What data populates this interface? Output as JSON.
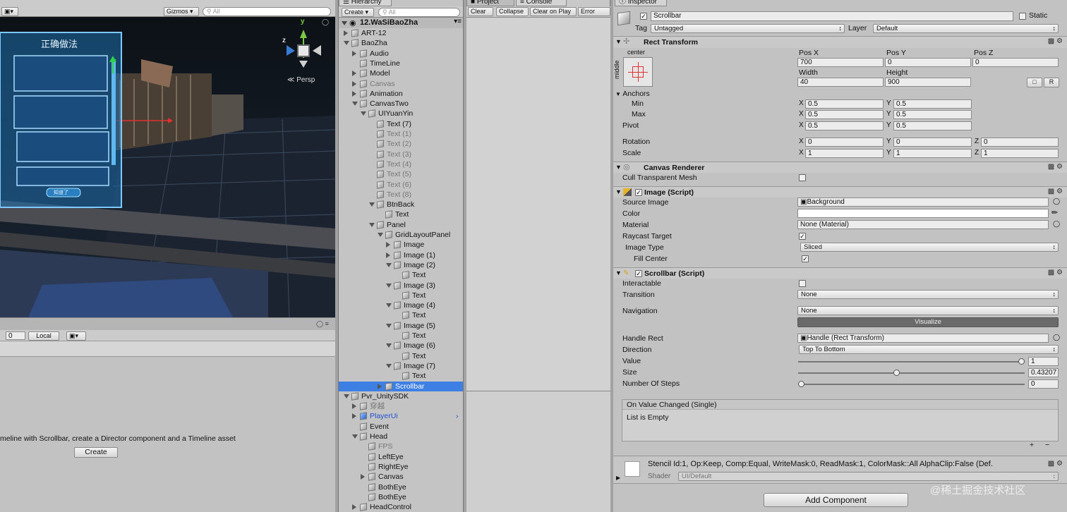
{
  "scene": {
    "gizmos": "Gizmos",
    "search_placeholder": "All",
    "persp": "Persp",
    "axis_y": "y",
    "axis_z": "z",
    "panel_title": "正确做法",
    "panel_button": "知道了"
  },
  "timeline": {
    "frame": "0",
    "local": "Local",
    "message": "meline with Scrollbar, create a Director component and a Timeline asset",
    "create": "Create"
  },
  "hierarchy": {
    "tab": "Hierarchy",
    "create": "Create",
    "search_placeholder": "All",
    "scene_name": "12.WaSiBaoZha",
    "rows": [
      {
        "label": "ART-12",
        "depth": 1,
        "tri": "closed",
        "style": ""
      },
      {
        "label": "BaoZha",
        "depth": 1,
        "tri": "open",
        "style": ""
      },
      {
        "label": "Audio",
        "depth": 2,
        "tri": "closed",
        "style": ""
      },
      {
        "label": "TimeLine",
        "depth": 2,
        "tri": "",
        "style": ""
      },
      {
        "label": "Model",
        "depth": 2,
        "tri": "closed",
        "style": ""
      },
      {
        "label": "Canvas",
        "depth": 2,
        "tri": "closed",
        "style": "dim"
      },
      {
        "label": "Animation",
        "depth": 2,
        "tri": "closed",
        "style": ""
      },
      {
        "label": "CanvasTwo",
        "depth": 2,
        "tri": "open",
        "style": ""
      },
      {
        "label": "UIYuanYin",
        "depth": 3,
        "tri": "open",
        "style": ""
      },
      {
        "label": "Text (7)",
        "depth": 4,
        "tri": "",
        "style": ""
      },
      {
        "label": "Text (1)",
        "depth": 4,
        "tri": "",
        "style": "dim"
      },
      {
        "label": "Text (2)",
        "depth": 4,
        "tri": "",
        "style": "dim"
      },
      {
        "label": "Text (3)",
        "depth": 4,
        "tri": "",
        "style": "dim"
      },
      {
        "label": "Text (4)",
        "depth": 4,
        "tri": "",
        "style": "dim"
      },
      {
        "label": "Text (5)",
        "depth": 4,
        "tri": "",
        "style": "dim"
      },
      {
        "label": "Text (6)",
        "depth": 4,
        "tri": "",
        "style": "dim"
      },
      {
        "label": "Text (8)",
        "depth": 4,
        "tri": "",
        "style": "dim"
      },
      {
        "label": "BtnBack",
        "depth": 4,
        "tri": "open",
        "style": ""
      },
      {
        "label": "Text",
        "depth": 5,
        "tri": "",
        "style": ""
      },
      {
        "label": "Panel",
        "depth": 4,
        "tri": "open",
        "style": ""
      },
      {
        "label": "GridLayoutPanel",
        "depth": 5,
        "tri": "open",
        "style": ""
      },
      {
        "label": "Image",
        "depth": 6,
        "tri": "closed",
        "style": ""
      },
      {
        "label": "Image (1)",
        "depth": 6,
        "tri": "closed",
        "style": ""
      },
      {
        "label": "Image (2)",
        "depth": 6,
        "tri": "open",
        "style": ""
      },
      {
        "label": "Text",
        "depth": 7,
        "tri": "",
        "style": ""
      },
      {
        "label": "Image (3)",
        "depth": 6,
        "tri": "open",
        "style": ""
      },
      {
        "label": "Text",
        "depth": 7,
        "tri": "",
        "style": ""
      },
      {
        "label": "Image (4)",
        "depth": 6,
        "tri": "open",
        "style": ""
      },
      {
        "label": "Text",
        "depth": 7,
        "tri": "",
        "style": ""
      },
      {
        "label": "Image (5)",
        "depth": 6,
        "tri": "open",
        "style": ""
      },
      {
        "label": "Text",
        "depth": 7,
        "tri": "",
        "style": ""
      },
      {
        "label": "Image (6)",
        "depth": 6,
        "tri": "open",
        "style": ""
      },
      {
        "label": "Text",
        "depth": 7,
        "tri": "",
        "style": ""
      },
      {
        "label": "Image (7)",
        "depth": 6,
        "tri": "open",
        "style": ""
      },
      {
        "label": "Text",
        "depth": 7,
        "tri": "",
        "style": ""
      },
      {
        "label": "Scrollbar",
        "depth": 5,
        "tri": "closed",
        "style": "sel"
      },
      {
        "label": "Pvr_UnitySDK",
        "depth": 1,
        "tri": "open",
        "style": ""
      },
      {
        "label": "穿越",
        "depth": 2,
        "tri": "closed",
        "style": "dim"
      },
      {
        "label": "PlayerUi",
        "depth": 2,
        "tri": "closed",
        "style": "blue"
      },
      {
        "label": "Event",
        "depth": 2,
        "tri": "",
        "style": ""
      },
      {
        "label": "Head",
        "depth": 2,
        "tri": "open",
        "style": ""
      },
      {
        "label": "FPS",
        "depth": 3,
        "tri": "",
        "style": "dim"
      },
      {
        "label": "LeftEye",
        "depth": 3,
        "tri": "",
        "style": ""
      },
      {
        "label": "RightEye",
        "depth": 3,
        "tri": "",
        "style": ""
      },
      {
        "label": "Canvas",
        "depth": 3,
        "tri": "closed",
        "style": ""
      },
      {
        "label": "BothEye",
        "depth": 3,
        "tri": "",
        "style": ""
      },
      {
        "label": "BothEye",
        "depth": 3,
        "tri": "",
        "style": ""
      },
      {
        "label": "HeadControl",
        "depth": 2,
        "tri": "closed",
        "style": ""
      }
    ]
  },
  "console": {
    "tab_project": "Project",
    "tab_console": "Console",
    "clear": "Clear",
    "collapse": "Collapse",
    "clear_on_play": "Clear on Play",
    "error_pause": "Error Pau"
  },
  "inspector": {
    "tab": "Inspector",
    "object_name": "Scrollbar",
    "static": "Static",
    "tag_label": "Tag",
    "tag_value": "Untagged",
    "layer_label": "Layer",
    "layer_value": "Default",
    "rect_transform": {
      "title": "Rect Transform",
      "anchor_h": "center",
      "anchor_v": "middle",
      "pos_x_label": "Pos X",
      "pos_y_label": "Pos Y",
      "pos_z_label": "Pos Z",
      "pos_x": "700",
      "pos_y": "0",
      "pos_z": "0",
      "width_label": "Width",
      "height_label": "Height",
      "width": "40",
      "height": "900",
      "r_button": "R",
      "anchors": "Anchors",
      "min": "Min",
      "max": "Max",
      "min_x": "0.5",
      "min_y": "0.5",
      "max_x": "0.5",
      "max_y": "0.5",
      "pivot": "Pivot",
      "pivot_x": "0.5",
      "pivot_y": "0.5",
      "rotation": "Rotation",
      "rot_x": "0",
      "rot_y": "0",
      "rot_z": "0",
      "scale": "Scale",
      "scale_x": "1",
      "scale_y": "1",
      "scale_z": "1",
      "x": "X",
      "y": "Y",
      "z": "Z"
    },
    "canvas_renderer": {
      "title": "Canvas Renderer",
      "cull": "Cull Transparent Mesh"
    },
    "image": {
      "title": "Image (Script)",
      "source_image_label": "Source Image",
      "source_image": "Background",
      "color_label": "Color",
      "material_label": "Material",
      "material": "None (Material)",
      "raycast_label": "Raycast Target",
      "image_type_label": "Image Type",
      "image_type": "Sliced",
      "fill_center_label": "Fill Center"
    },
    "scrollbar": {
      "title": "Scrollbar (Script)",
      "interactable": "Interactable",
      "transition_label": "Transition",
      "transition": "None",
      "navigation_label": "Navigation",
      "navigation": "None",
      "visualize": "Visualize",
      "handle_rect_label": "Handle Rect",
      "handle_rect": "Handle (Rect Transform)",
      "direction_label": "Direction",
      "direction": "Top To Bottom",
      "value_label": "Value",
      "value": "1",
      "value_fraction": 1.0,
      "size_label": "Size",
      "size": "0.43207",
      "size_fraction": 0.43207,
      "steps_label": "Number Of Steps",
      "steps": "0",
      "steps_fraction": 0,
      "event_title": "On Value Changed (Single)",
      "event_body": "List is Empty",
      "plus": "+",
      "minus": "−"
    },
    "material": {
      "desc": "Stencil Id:1, Op:Keep, Comp:Equal, WriteMask:0, ReadMask:1, ColorMask::All AlphaClip:False (Def.",
      "shader_label": "Shader",
      "shader": "UI/Default"
    },
    "add_component": "Add Component",
    "watermark": "@稀土掘金技术社区"
  }
}
